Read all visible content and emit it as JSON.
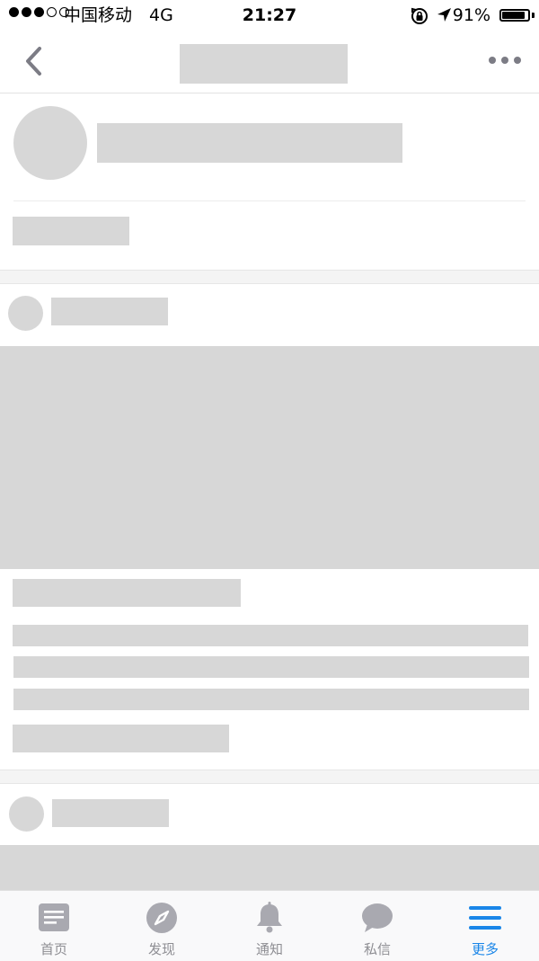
{
  "status_bar": {
    "carrier": "中国移动",
    "network": "4G",
    "time": "21:27",
    "battery_percent": "91%",
    "battery_level": 0.91,
    "signal_strength": 3,
    "signal_max": 5
  },
  "nav": {
    "back_icon": "chevron-left-icon",
    "more_icon": "more-dots-icon"
  },
  "tabbar": {
    "active_color": "#1a86e8",
    "inactive_color": "#8e8e93",
    "tabs": [
      {
        "label": "首页",
        "icon": "home-icon"
      },
      {
        "label": "发现",
        "icon": "compass-icon"
      },
      {
        "label": "通知",
        "icon": "bell-icon"
      },
      {
        "label": "私信",
        "icon": "chat-bubble-icon"
      },
      {
        "label": "更多",
        "icon": "menu-icon",
        "active": true
      }
    ]
  }
}
